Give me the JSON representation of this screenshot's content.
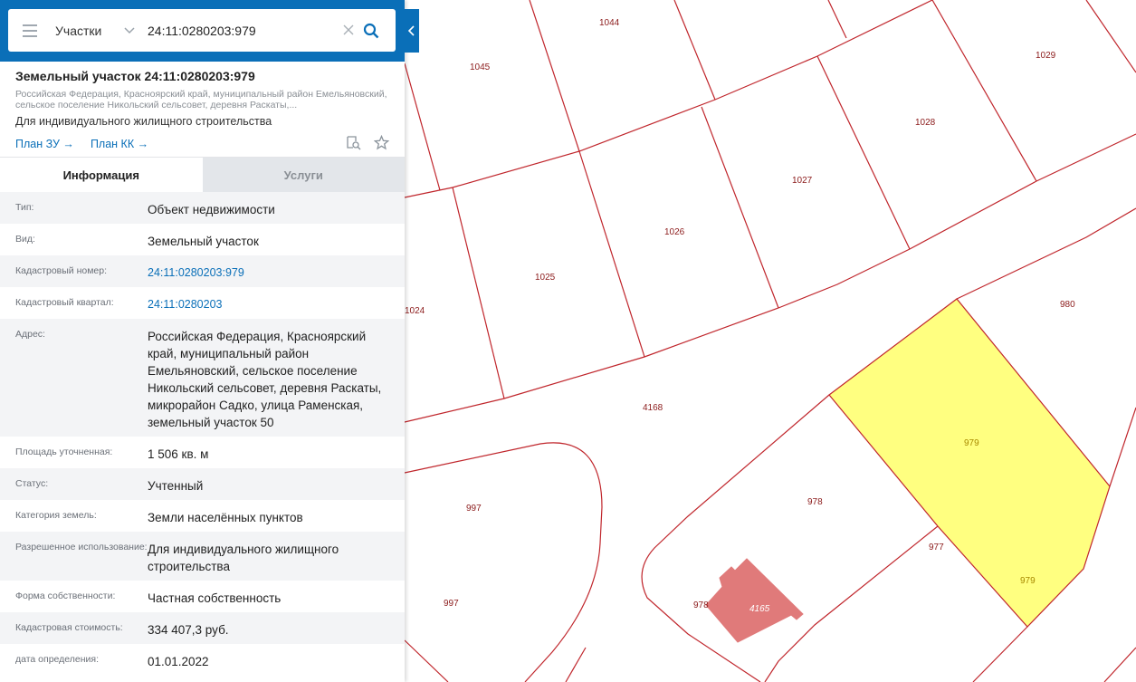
{
  "search": {
    "type_label": "Участки",
    "query": "24:11:0280203:979"
  },
  "object": {
    "title": "Земельный участок 24:11:0280203:979",
    "address_short": "Российская Федерация, Красноярский край, муниципальный район Емельяновский, сельское поселение Никольский сельсовет, деревня Раскаты,...",
    "purpose": "Для индивидуального жилищного строительства",
    "link_plan_zu": "План ЗУ →",
    "link_plan_kk": "План КК →"
  },
  "tabs": [
    {
      "label": "Информация",
      "active": true
    },
    {
      "label": "Услуги",
      "active": false
    }
  ],
  "info": [
    {
      "label": "Тип:",
      "value": "Объект недвижимости"
    },
    {
      "label": "Вид:",
      "value": "Земельный участок"
    },
    {
      "label": "Кадастровый номер:",
      "value": "24:11:0280203:979",
      "link": true
    },
    {
      "label": "Кадастровый квартал:",
      "value": "24:11:0280203",
      "link": true
    },
    {
      "label": "Адрес:",
      "value": "Российская Федерация, Красноярский край, муниципальный район Емельяновский, сельское поселение Никольский сельсовет, деревня Раскаты, микрорайон Садко, улица Раменская, земельный участок 50"
    },
    {
      "label": "Площадь уточненная:",
      "value": "1 506 кв. м"
    },
    {
      "label": "Статус:",
      "value": "Учтенный"
    },
    {
      "label": "Категория земель:",
      "value": "Земли населённых пунктов"
    },
    {
      "label": "Разрешенное использование:",
      "value": "Для индивидуального жилищного строительства"
    },
    {
      "label": "Форма собственности:",
      "value": "Частная собственность"
    },
    {
      "label": "Кадастровая стоимость:",
      "value": "334 407,3 руб."
    },
    {
      "label": "дата определения:",
      "value": "01.01.2022"
    }
  ],
  "map": {
    "plot_labels": [
      "1044",
      "1045",
      "1029",
      "1028",
      "1027",
      "1026",
      "1025",
      "1024",
      "980",
      "4168",
      "979",
      "978",
      "977",
      "997",
      "997",
      "978",
      "4165",
      "979"
    ],
    "colors": {
      "boundary": "#c0262c",
      "selected_fill": "#ffff80",
      "building_fill": "#e07a7a",
      "accent": "#0a6fb8"
    }
  },
  "icons": {
    "menu": "menu-icon",
    "chevron": "chevron-down-icon",
    "clear": "close-icon",
    "search": "search-icon",
    "collapse": "chevron-left-icon",
    "zoom_doc": "document-search-icon",
    "favorite": "star-icon"
  }
}
